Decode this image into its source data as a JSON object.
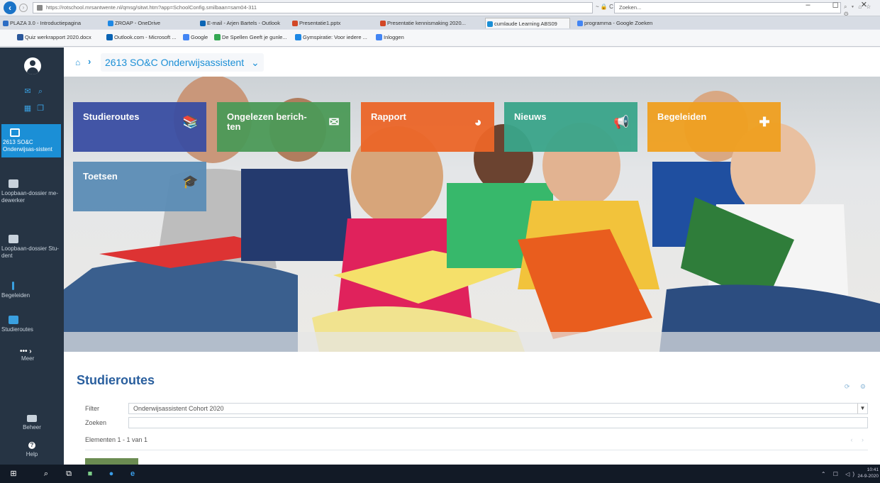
{
  "browser": {
    "url": "https://rotschool.mrsantwente.nl/qmsg/sitwt.htm?app=SchoolConfig.smilbaan=sam04-311",
    "url_tools": "~ 🔒 C",
    "search_placeholder": "Zoeken...",
    "search_tools": "⌕ ▾  ⌂ ☆ ⚙",
    "window_controls": "– ◻ ✕",
    "tabs": [
      {
        "label": "PLAZA 3.0 - Introductiepagina",
        "color": "#2b6cc4"
      },
      {
        "label": "ZROAP - OneDrive",
        "color": "#1e88e5"
      },
      {
        "label": "E-mail - Arjen Bartels - Outlook",
        "color": "#0a64b4"
      },
      {
        "label": "Presentatie1.pptx",
        "color": "#d24726"
      },
      {
        "label": "Presentatie kennismaking 2020...",
        "color": "#d24726"
      },
      {
        "label": "cumlaude Learning ABS09",
        "color": "#1b8fd6"
      },
      {
        "label": "programma - Google Zoeken",
        "color": "#4285f4"
      }
    ],
    "favorites": [
      {
        "label": "Quiz werkrapport 2020.docx",
        "color": "#2b579a"
      },
      {
        "label": "Outlook.com - Microsoft ...",
        "color": "#0a64b4"
      },
      {
        "label": "Google",
        "color": "#4285f4"
      },
      {
        "label": "De Spellen Geeft je gunle...",
        "color": "#34a853"
      },
      {
        "label": "Gymspiratie: Voor iedere ...",
        "color": "#1e88e5"
      },
      {
        "label": "Inloggen",
        "color": "#4285f4"
      }
    ]
  },
  "sidebar": {
    "nav": [
      {
        "label": "2613 SO&C Onderwijsas-sistent",
        "active": true,
        "icon": "grid-icon"
      },
      {
        "label": "Loopbaan-dossier me-dewerker",
        "active": false,
        "icon": "calendar-icon"
      },
      {
        "label": "Loopbaan-dossier Stu-dent",
        "active": false,
        "icon": "calendar-icon"
      },
      {
        "label": "Begeleiden",
        "active": false,
        "icon": "signpost-icon"
      },
      {
        "label": "Studieroutes",
        "active": false,
        "icon": "books-icon"
      },
      {
        "label": "Meer",
        "active": false,
        "icon": "more-icon"
      }
    ],
    "more_glyph": "••• ›",
    "beheer_label": "Beheer",
    "help_label": "Help"
  },
  "breadcrumb": {
    "home_glyph": "⌂",
    "separator": "›",
    "course": "2613 SO&C Onderwijsassistent",
    "dropdown_glyph": "⌄"
  },
  "tiles": [
    {
      "label": "Studieroutes",
      "color": "#3a4ea3",
      "glyph": "📚",
      "icon": "books-icon"
    },
    {
      "label": "Ongelezen berich-ten",
      "color": "#4c9a58",
      "glyph": "✉",
      "icon": "mail-icon"
    },
    {
      "label": "Rapport",
      "color": "#ec6628",
      "glyph": "◕",
      "icon": "pie-chart-icon"
    },
    {
      "label": "Nieuws",
      "color": "#3aa58a",
      "glyph": "📢",
      "icon": "megaphone-icon"
    },
    {
      "label": "Begeleiden",
      "color": "#f0a020",
      "glyph": "✚",
      "icon": "signpost-icon"
    },
    {
      "label": "Toetsen",
      "color": "#5c8db6",
      "glyph": "🎓",
      "icon": "graduation-cap-icon"
    }
  ],
  "content": {
    "title": "Studieroutes",
    "tools": "⟳ ⚙",
    "filter_label": "Filter",
    "filter_value": "Onderwijsassistent Cohort 2020",
    "search_label": "Zoeken",
    "search_value": "",
    "count": "Elementen 1 - 1 van 1",
    "pager": "‹ ›"
  },
  "taskbar": {
    "tray": "⌃ ☐ ◁)",
    "time": "10:41",
    "date": "24-9-2020"
  }
}
